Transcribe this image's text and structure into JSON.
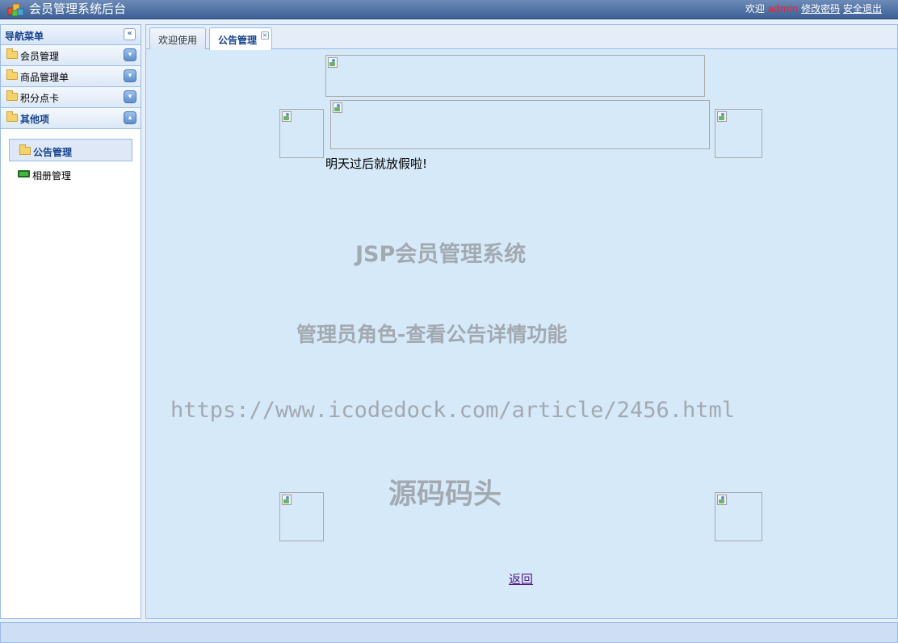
{
  "header": {
    "title": "会员管理系统后台",
    "welcome": "欢迎",
    "username": "admin",
    "change_password": "修改密码",
    "logout": "安全退出"
  },
  "sidebar": {
    "title": "导航菜单",
    "groups": [
      {
        "label": "会员管理",
        "expanded": false
      },
      {
        "label": "商品管理单",
        "expanded": false
      },
      {
        "label": "积分点卡",
        "expanded": false
      },
      {
        "label": "其他项",
        "expanded": true
      }
    ],
    "sub_items": [
      {
        "label": "公告管理",
        "selected": true,
        "icon": "folder-icon"
      },
      {
        "label": "相册管理",
        "selected": false,
        "icon": "album-icon"
      }
    ]
  },
  "tabs": [
    {
      "label": "欢迎使用",
      "active": false
    },
    {
      "label": "公告管理",
      "active": true
    }
  ],
  "content": {
    "notice_text": "明天过后就放假啦!",
    "back_link": "返回"
  },
  "watermark": {
    "line1": "JSP会员管理系统",
    "line2": "管理员角色-查看公告详情功能",
    "line3": "https://www.icodedock.com/article/2456.html",
    "line4": "源码码头"
  },
  "colors": {
    "header": "#3c5f95",
    "panel_border": "#99bbe8",
    "content_bg": "#d6e9f8",
    "username": "#e8232e"
  }
}
